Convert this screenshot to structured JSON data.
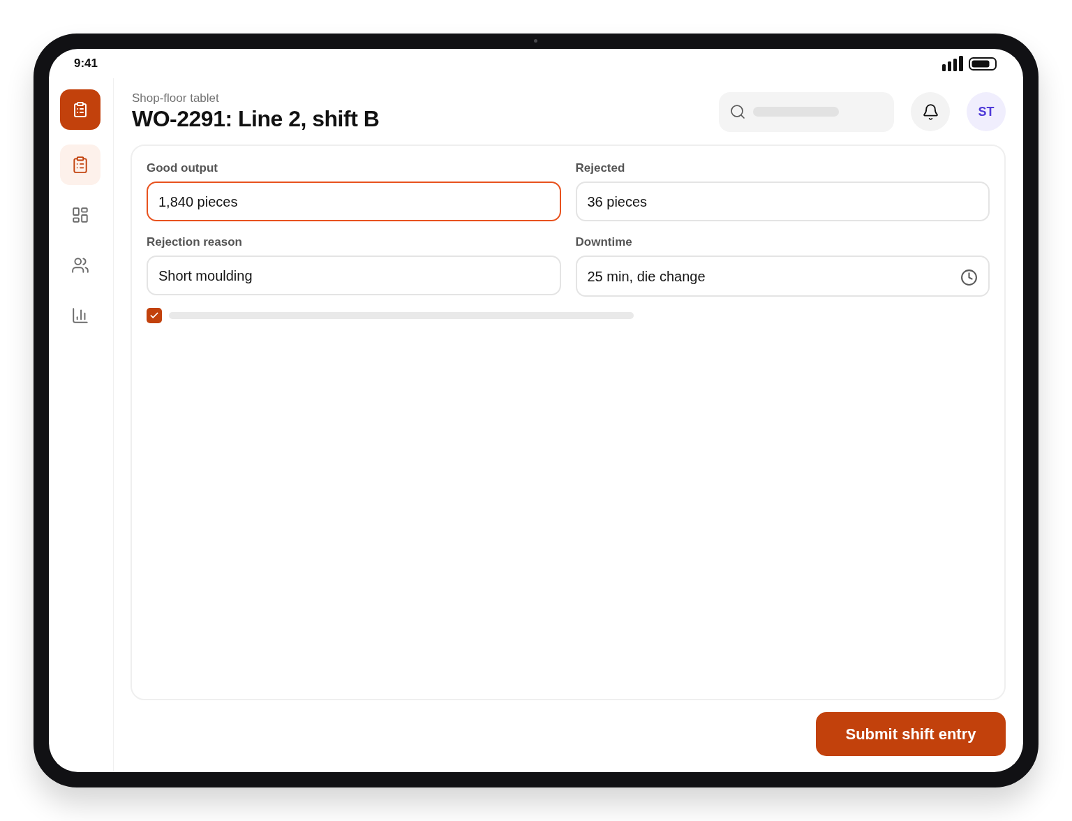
{
  "status_bar": {
    "time": "9:41"
  },
  "sidebar": {
    "items": [
      {
        "selected": true
      },
      {
        "selected": false
      },
      {
        "selected": false
      },
      {
        "selected": false
      }
    ]
  },
  "header": {
    "subtitle": "Shop-floor tablet",
    "title": "WO-2291: Line 2, shift B",
    "avatar": {
      "initials": "ST"
    }
  },
  "form": {
    "fields": [
      {
        "kind": "text",
        "label": "Good output",
        "value": "1,840 pieces",
        "focused": true
      },
      {
        "kind": "text",
        "label": "Rejected",
        "value": "36 pieces",
        "focused": false
      },
      {
        "kind": "text",
        "label": "Rejection reason",
        "value": "Short moulding",
        "focused": false
      },
      {
        "kind": "time",
        "label": "Downtime",
        "value": "25 min, die change",
        "focused": false
      }
    ],
    "checkbox": {
      "checked": true
    }
  },
  "submit_button": {
    "label": "Submit shift entry"
  }
}
